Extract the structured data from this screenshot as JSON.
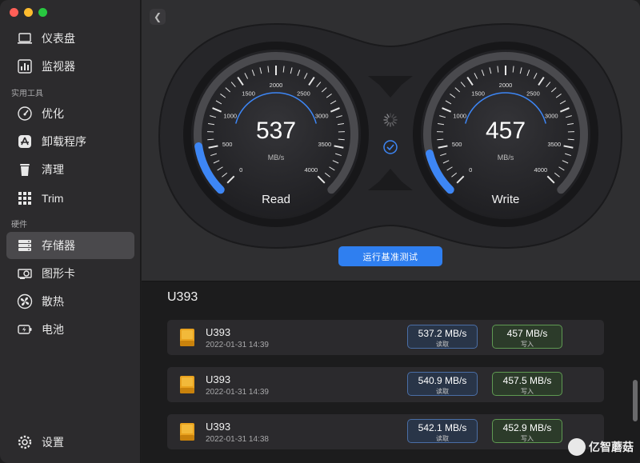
{
  "sidebar": {
    "items": [
      {
        "label": "仪表盘",
        "icon": "laptop-icon"
      },
      {
        "label": "监视器",
        "icon": "chart-icon"
      },
      {
        "label": "优化",
        "icon": "gauge-icon"
      },
      {
        "label": "卸载程序",
        "icon": "app-store-icon"
      },
      {
        "label": "清理",
        "icon": "trash-icon"
      },
      {
        "label": "Trim",
        "icon": "grid-icon"
      },
      {
        "label": "存储器",
        "icon": "storage-icon"
      },
      {
        "label": "图形卡",
        "icon": "gpu-icon"
      },
      {
        "label": "散热",
        "icon": "fan-icon"
      },
      {
        "label": "电池",
        "icon": "battery-icon"
      }
    ],
    "sections": {
      "tools": "实用工具",
      "hardware": "硬件"
    },
    "settings": "设置"
  },
  "gauges": {
    "read": {
      "value": "537",
      "unit": "MB/s",
      "label": "Read",
      "fraction": 0.134
    },
    "write": {
      "value": "457",
      "unit": "MB/s",
      "label": "Write",
      "fraction": 0.114
    },
    "ticks": [
      "0",
      "500",
      "1000",
      "1500",
      "2000",
      "2500",
      "3000",
      "3500",
      "4000"
    ]
  },
  "run_button": "运行基准测试",
  "drive": {
    "title": "U393",
    "results": [
      {
        "name": "U393",
        "date": "2022-01-31 14:39",
        "read": "537.2 MB/s",
        "read_label": "读取",
        "write": "457 MB/s",
        "write_label": "写入"
      },
      {
        "name": "U393",
        "date": "2022-01-31 14:39",
        "read": "540.9 MB/s",
        "read_label": "读取",
        "write": "457.5 MB/s",
        "write_label": "写入"
      },
      {
        "name": "U393",
        "date": "2022-01-31 14:38",
        "read": "542.1 MB/s",
        "read_label": "读取",
        "write": "452.9 MB/s",
        "write_label": "写入"
      }
    ]
  },
  "watermark": "亿智蘑菇",
  "colors": {
    "accent": "#2f7ff0",
    "gauge_arc": "#3d86f5",
    "read_border": "#4a6ea6",
    "write_border": "#5f9a52"
  }
}
